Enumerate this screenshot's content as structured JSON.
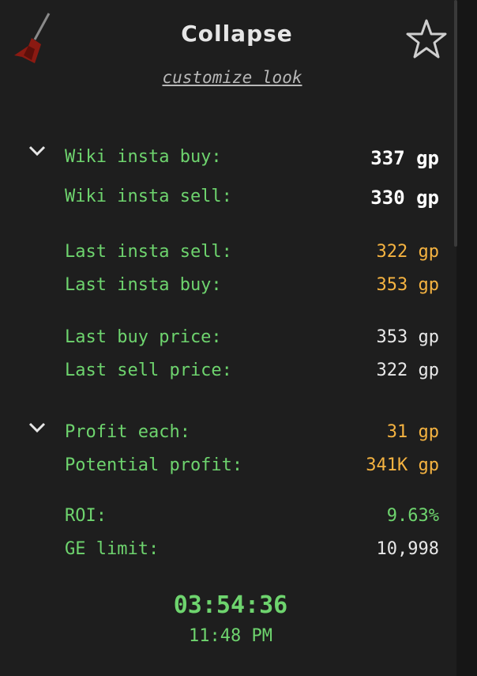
{
  "header": {
    "title": "Collapse",
    "customize_label": "customize look",
    "item_icon": "dart-item-icon",
    "favorite_icon": "star-icon"
  },
  "prices": {
    "wiki_insta_buy": {
      "label": "Wiki insta buy:",
      "value": "337 gp"
    },
    "wiki_insta_sell": {
      "label": "Wiki insta sell:",
      "value": "330 gp"
    },
    "last_insta_sell": {
      "label": "Last insta sell:",
      "value": "322 gp"
    },
    "last_insta_buy": {
      "label": "Last insta buy:",
      "value": "353 gp"
    },
    "last_buy_price": {
      "label": "Last buy price:",
      "value": "353 gp"
    },
    "last_sell_price": {
      "label": "Last sell price:",
      "value": "322 gp"
    }
  },
  "profit": {
    "profit_each": {
      "label": "Profit each:",
      "value": "31 gp"
    },
    "potential_profit": {
      "label": "Potential profit:",
      "value": "341K gp"
    },
    "roi": {
      "label": "ROI:",
      "value": "9.63%"
    },
    "ge_limit": {
      "label": "GE limit:",
      "value": "10,998"
    }
  },
  "footer": {
    "timer": "03:54:36",
    "clock": "11:48 PM"
  },
  "colors": {
    "background": "#1e1e1e",
    "label_green": "#6ed46e",
    "value_gold": "#f5b341",
    "value_white": "#e8e8e8"
  }
}
